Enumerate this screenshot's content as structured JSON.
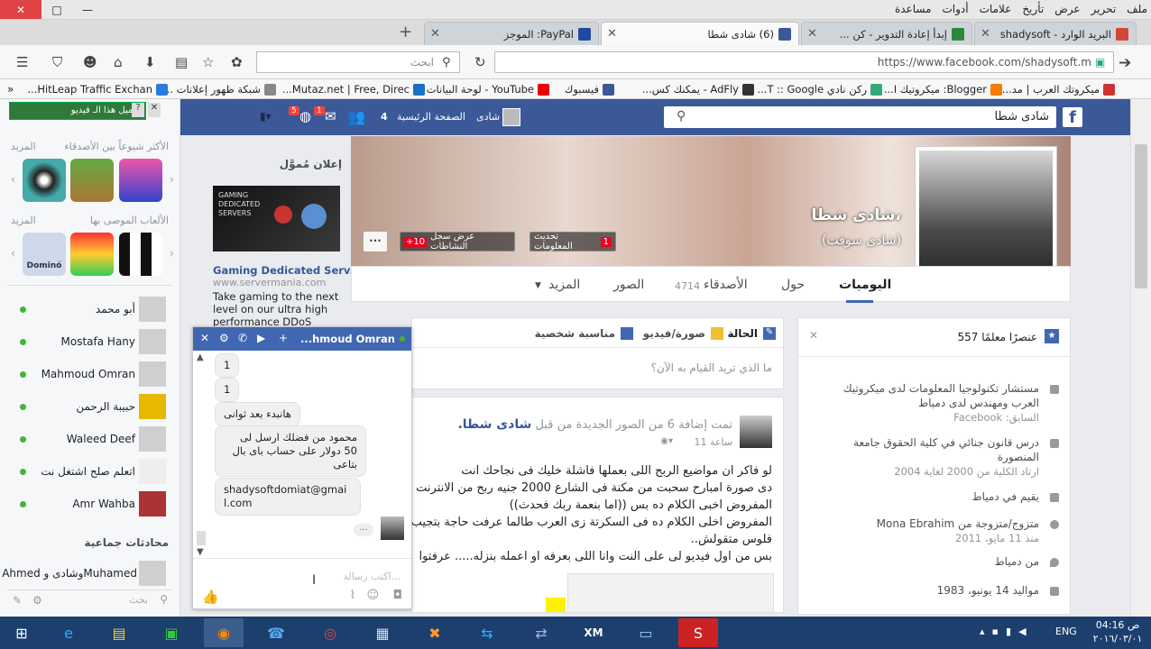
{
  "menubar": {
    "items": [
      "ملف",
      "تحرير",
      "عرض",
      "تأريخ",
      "علامات",
      "أدوات",
      "مساعدة"
    ]
  },
  "tabs": [
    {
      "title": "البريد الوارد - shadysoft",
      "color": "#d44638"
    },
    {
      "title": "إبدأ إعادة التدوير - كن ...",
      "color": "#2a8a3a"
    },
    {
      "title": "(6) شادى شطا",
      "color": "#3b5998"
    },
    {
      "title": "PayPal: الموجز",
      "color": "#1f4aa0"
    }
  ],
  "navbar": {
    "url": "https://www.facebook.com/shadysoft.m",
    "search_placeholder": "ابحث"
  },
  "bookmarks": [
    {
      "label": "ميكروتك العرب | مد...",
      "color": "#c33"
    },
    {
      "label": "Blogger: ميكروتيك ا...",
      "color": "#f57d00"
    },
    {
      "label": "ركن نادي T :: Google...",
      "color": "#3a7"
    },
    {
      "label": "AdFly - يمكنك كس...",
      "color": "#333"
    },
    {
      "label": "فيسبوك",
      "color": "#3b5998"
    },
    {
      "label": "YouTube - لوحة البيانات",
      "color": "#e00"
    },
    {
      "label": "Mutaz.net | Free, Direc...",
      "color": "#1a6fc7"
    },
    {
      "label": "شبكة ظهور إعلانات ...",
      "color": "#888"
    },
    {
      "label": "HitLeap Traffic Exchan...",
      "color": "#2a7ae0"
    }
  ],
  "fbtop": {
    "search_value": "شادى شطا",
    "user": "شادى",
    "home": "الصفحة الرئيسية",
    "home_count": "4",
    "friend_badge": "1",
    "notif_badge": "5"
  },
  "sidebar": {
    "video_btn": "تحميل هذا الـ فيديو",
    "frequent": "الأكثر شيوعاً بين الأصدقاء",
    "more1": "المزيد",
    "recommended": "الألعاب الموصى بها",
    "more2": "المزيد",
    "group_header": "محادثات جماعية",
    "search_placeholder": "بحث",
    "contacts": [
      "أبو محمد",
      "Mostafa Hany",
      "Mahmoud Omran",
      "حبيبة الرحمن",
      "Waleed Deef",
      "اتعلم صلح اشتغل نت",
      "Amr Wahba"
    ],
    "group": "Ahmed وشادى وMuhamed",
    "domino": "Dominó"
  },
  "ads": {
    "header": "إعلان مُموَّل",
    "title": "Gaming Dedicated Serv...",
    "url": "www.servermania.com",
    "body": "Take gaming to the next level on our ultra high performance DDoS",
    "banner1": "GAMING",
    "banner2": "DEDICATED",
    "banner3": "SERVERS"
  },
  "profile": {
    "name": "شادى شطا،",
    "alt": "(شادى سوفت)",
    "update_info": "تحديث المعلومات",
    "update_badge": "1",
    "activity": "عرض سجل النشاطات",
    "activity_badge": "+10",
    "more": "..."
  },
  "profilenav": {
    "timeline": "اليوميات",
    "about": "حول",
    "friends": "الأصدقاء",
    "friends_count": "4714",
    "photos": "الصور",
    "more": "المزيد"
  },
  "composer": {
    "status": "الحالة",
    "photo": "صورة/فيديو",
    "event": "مناسبة شخصية",
    "placeholder": "ما الذي تريد القيام به الآن؟"
  },
  "post": {
    "author": "شادى شطا.",
    "action": "تمت إضافة 6 من الصور الجديدة من قبل",
    "time": "11 ساعة",
    "lines": [
      "لو فاكر ان مواضيع الربح اللى بعملها فاشلة خليك فى نجاحك انت",
      "دى صورة امبارح سحبت من مكنة فى الشارع 2000 جنيه ربح من الانترنت",
      "المفروض اخبى الكلام ده بس ((اما بنعمة ربك فحدث))",
      "المفروض اخلى الكلام ده فى السكرتة زى العرب طالما عرفت حاجة بتجيب",
      "فلوس متقولش..",
      "بس من اول فيديو لى على النت وانا اللى بعرفه او اعمله بنزله..... عرفتوا"
    ]
  },
  "intro": {
    "items_count": "557 عنصرًا معلمًا",
    "rows": [
      {
        "main": "مستشار تكنولوجيا المعلومات لدى ميكروتيك العرب ومهندس لدى دمياط",
        "sub": "السابق: Facebook"
      },
      {
        "main": "درس قانون جنائي في كلية الحقوق جامعة المنصورة",
        "sub": "ارتاد الكلية من 2000 لغاية 2004"
      },
      {
        "main": "يقيم في دمياط",
        "sub": ""
      },
      {
        "main": "متزوج/متزوجة من Mona Ebrahim",
        "sub": "منذ 11 مايو، 2011"
      },
      {
        "main": "من دمياط",
        "sub": ""
      },
      {
        "main": "مواليد 14 يونيو، 1983",
        "sub": ""
      }
    ]
  },
  "chat": {
    "name": "...hmoud Omran",
    "messages": [
      "1",
      "1",
      "هانبدء بعد ثوانى",
      "محمود من فضلك ارسل لى 50 دولار على حساب باى بال بتاعى",
      "shadysoftdomiat@gmail.com"
    ],
    "input_placeholder": "اكتب رسالة...",
    "more": "..."
  },
  "taskbar": {
    "lang": "ENG",
    "time": "04:16 ص",
    "date": "٢٠١٦/٠٣/٠١"
  }
}
